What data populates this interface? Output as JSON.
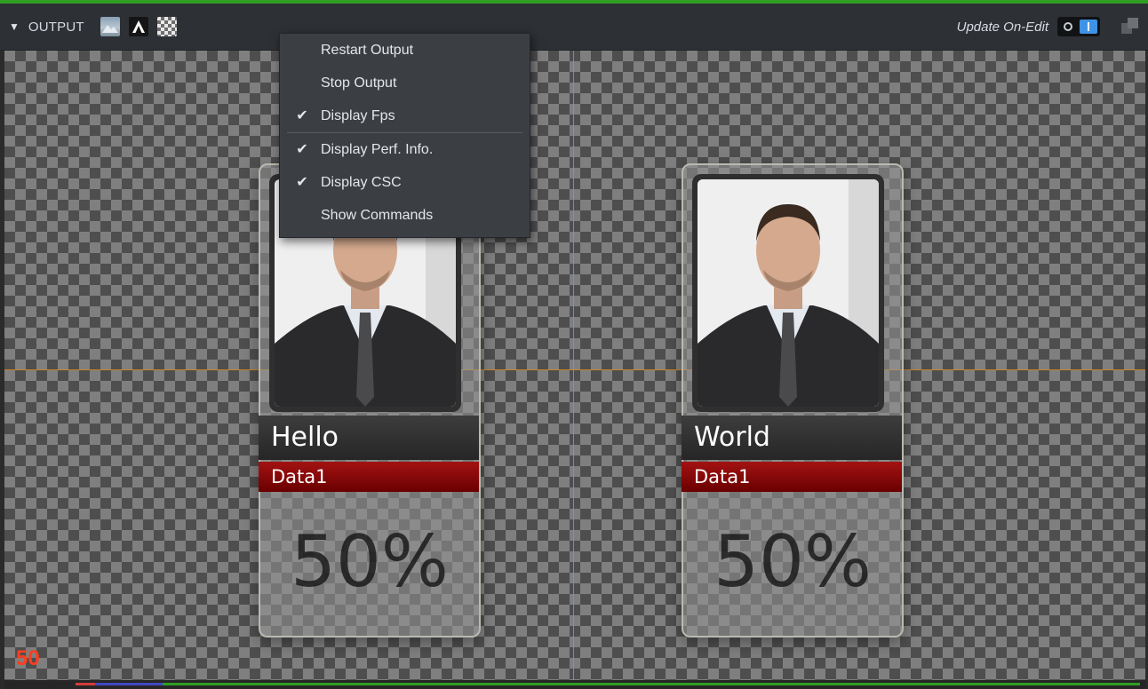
{
  "toolbar": {
    "title": "OUTPUT",
    "update_label": "Update On-Edit",
    "icons": [
      "collapse-triangle-icon",
      "image-view-icon",
      "text-view-icon",
      "alpha-view-icon",
      "toggle-switch",
      "popout-icon"
    ]
  },
  "menu": {
    "items": [
      {
        "label": "Restart Output",
        "checked": false
      },
      {
        "label": "Stop Output",
        "checked": false
      },
      {
        "label": "Display Fps",
        "checked": true
      },
      {
        "label": "Display Perf. Info.",
        "checked": true
      },
      {
        "label": "Display CSC",
        "checked": true
      },
      {
        "label": "Show Commands",
        "checked": false
      }
    ],
    "check_glyph": "✔"
  },
  "cards": [
    {
      "name": "Hello",
      "data": "Data1",
      "percent": "50%"
    },
    {
      "name": "World",
      "data": "Data1",
      "percent": "50%"
    }
  ],
  "fps": "50",
  "colors": {
    "accent_green": "#2f9e23",
    "guide_orange": "#d98a1a",
    "data_red": "#8b0000",
    "fps_red": "#ff3d1f",
    "toggle_blue": "#3f93e6"
  }
}
